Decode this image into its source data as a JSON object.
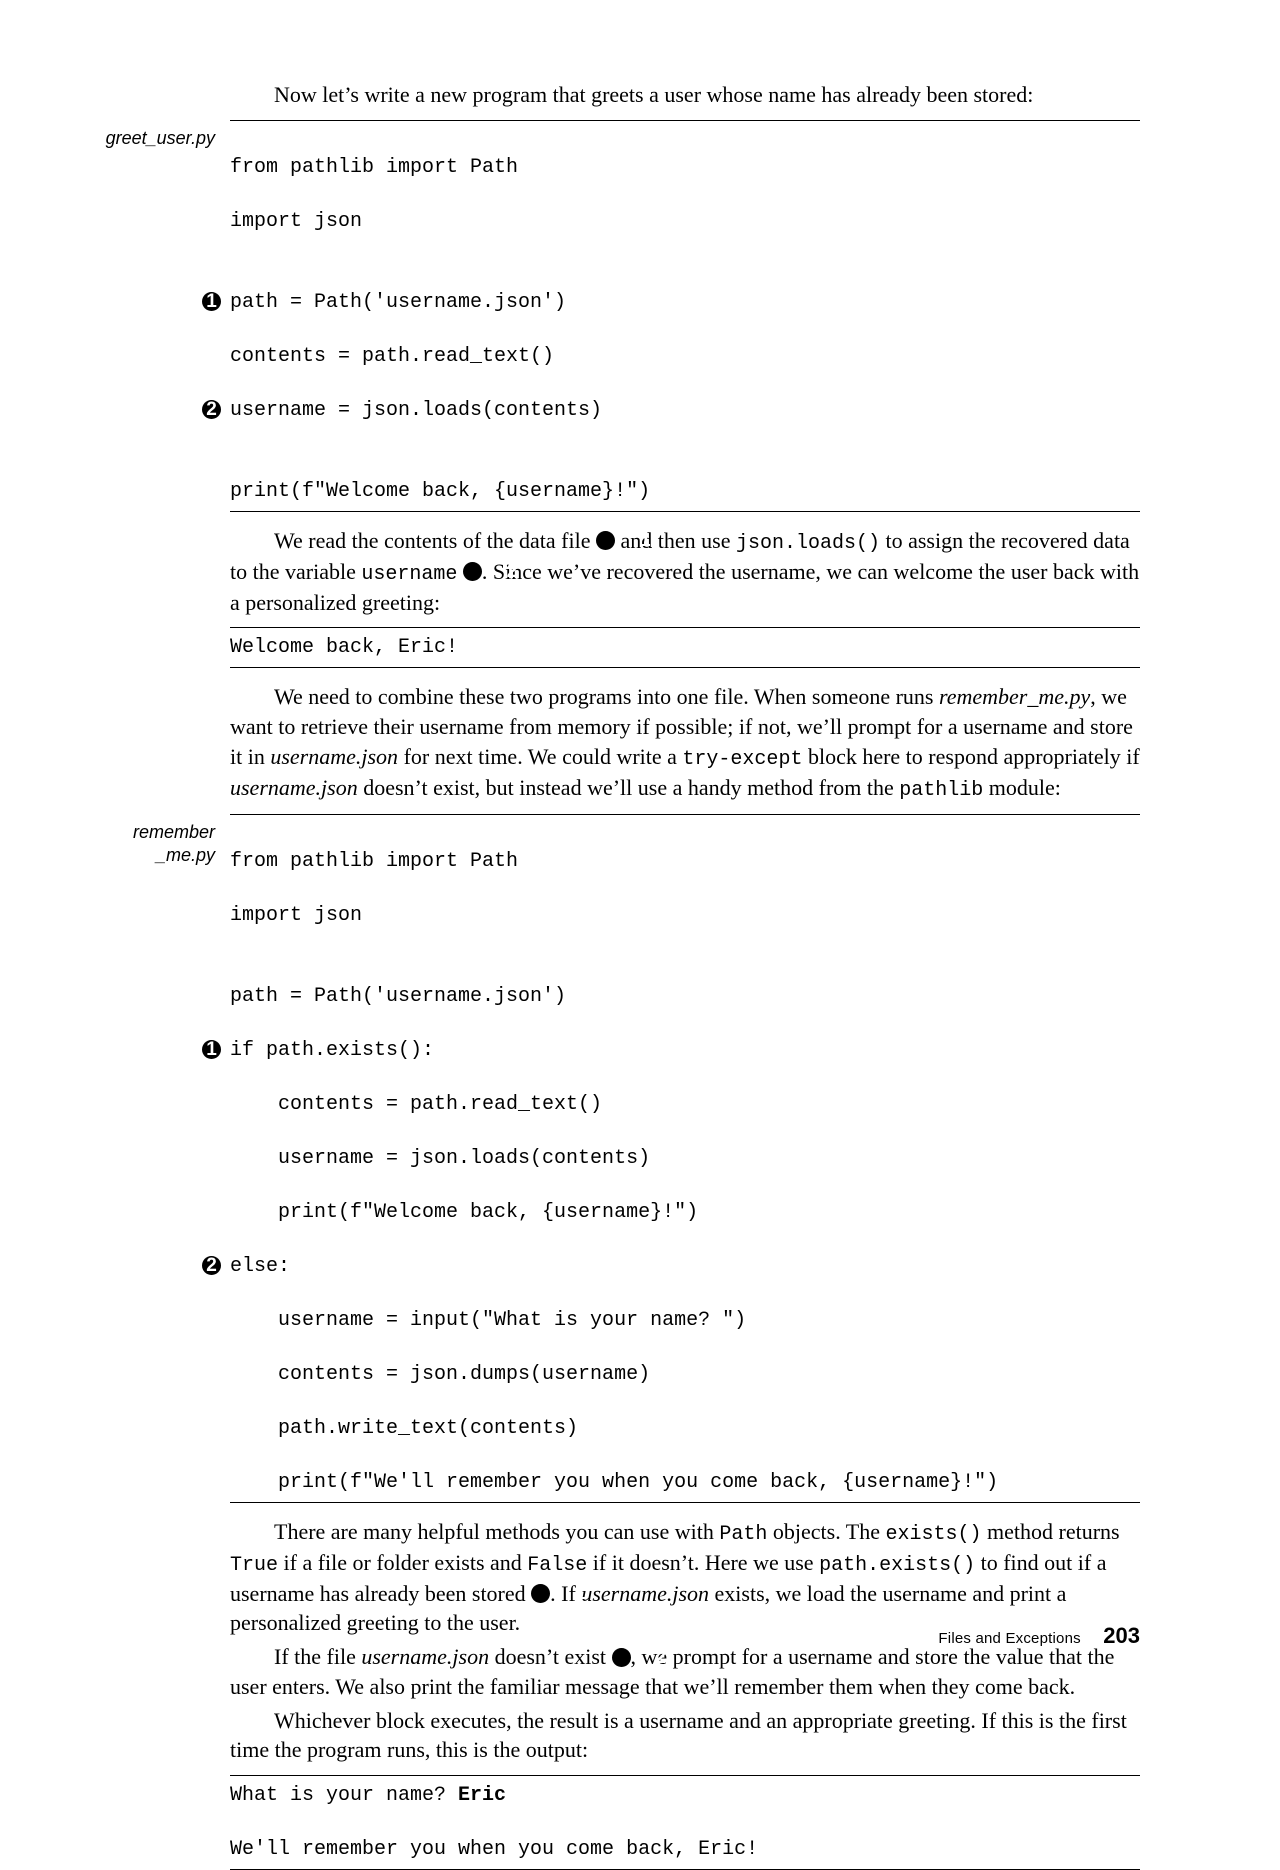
{
  "intro1": "Now let’s write a new program that greets a user whose name has already been stored:",
  "file1": "greet_user.py",
  "code1": {
    "l1": "from pathlib import Path",
    "l2": "import json",
    "l3": "",
    "l4": "path = Path('username.json')",
    "l5": "contents = path.read_text()",
    "l6": "username = json.loads(contents)",
    "l7": "",
    "l8": "print(f\"Welcome back, {username}!\")"
  },
  "para2a": "We read the contents of the data file ",
  "para2b": " and then use ",
  "para2c": "json.loads()",
  "para2d": " to assign the recovered data to the variable ",
  "para2e": "username",
  "para2f": ". Since we’ve recovered the username, we can welcome the user back with a personalized greeting:",
  "out1": "Welcome back, Eric!",
  "para3a": "We need to combine these two programs into one file. When someone runs ",
  "para3b": "remember_me.py",
  "para3c": ", we want to retrieve their username from memory if possible; if not, we’ll prompt for a username and store it in ",
  "para3d": "username.json",
  "para3e": " for next time. We could write a ",
  "para3f": "try-except",
  "para3g": " block here to respond appropriately if ",
  "para3h": "username.json",
  "para3i": " doesn’t exist, but instead we’ll use a handy method from the ",
  "para3j": "pathlib",
  "para3k": " module:",
  "file2a": "remember",
  "file2b": "_me.py",
  "code2": {
    "l1": "from pathlib import Path",
    "l2": "import json",
    "l3": "",
    "l4": "path = Path('username.json')",
    "l5": "if path.exists():",
    "l6": "    contents = path.read_text()",
    "l7": "    username = json.loads(contents)",
    "l8": "    print(f\"Welcome back, {username}!\")",
    "l9": "else:",
    "l10": "    username = input(\"What is your name? \")",
    "l11": "    contents = json.dumps(username)",
    "l12": "    path.write_text(contents)",
    "l13": "    print(f\"We'll remember you when you come back, {username}!\")"
  },
  "para4a": "There are many helpful methods you can use with ",
  "para4b": "Path",
  "para4c": " objects. The ",
  "para4d": "exists()",
  "para4e": " method returns ",
  "para4f": "True",
  "para4g": " if a file or folder exists and ",
  "para4h": "False",
  "para4i": " if it doesn’t. Here we use ",
  "para4j": "path.exists()",
  "para4k": " to find out if a username has already been stored ",
  "para4l": ". If ",
  "para4m": "username.json",
  "para4n": " exists, we load the username and print a personalized greeting to the user.",
  "para5a": "If the file ",
  "para5b": "username.json",
  "para5c": " doesn’t exist ",
  "para5d": ", we prompt for a username and store the value that the user enters. We also print the familiar message that we’ll remember them when they come back.",
  "para6": "Whichever block executes, the result is a username and an appropriate greeting. If this is the first time the program runs, this is the output:",
  "out2a": "What is your name? ",
  "out2b": "Eric",
  "out2c": "We'll remember you when you come back, Eric!",
  "footer": {
    "chapter": "Files and Exceptions",
    "page": "203"
  },
  "marks": {
    "one": "1",
    "two": "2"
  }
}
